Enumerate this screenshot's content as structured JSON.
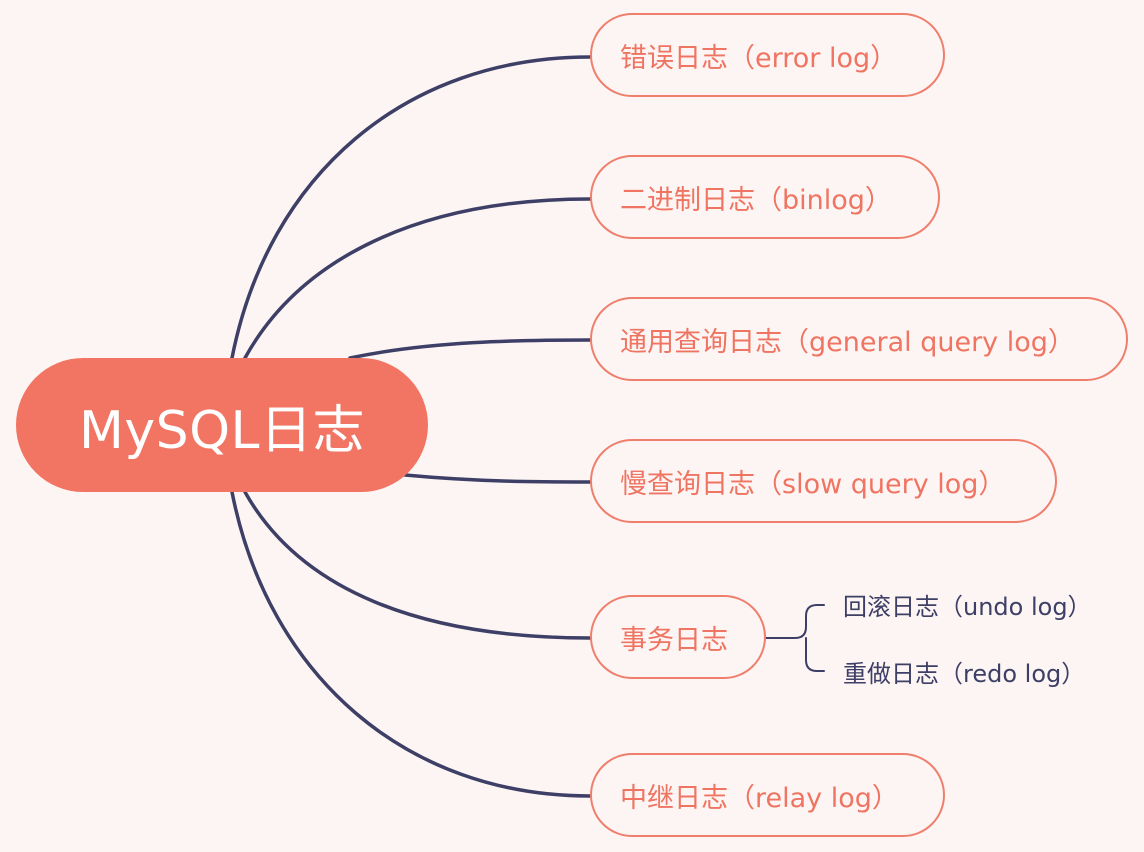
{
  "root": {
    "label": "MySQL日志"
  },
  "branches": [
    {
      "id": "error",
      "label": "错误日志（error log）"
    },
    {
      "id": "binlog",
      "label": "二进制日志（binlog）"
    },
    {
      "id": "general",
      "label": "通用查询日志（general query log）"
    },
    {
      "id": "slow",
      "label": "慢查询日志（slow query log）"
    },
    {
      "id": "transaction",
      "label": "事务日志",
      "children": [
        {
          "id": "undo",
          "label": "回滚日志（undo log）"
        },
        {
          "id": "redo",
          "label": "重做日志（redo log）"
        }
      ]
    },
    {
      "id": "relay",
      "label": "中继日志（relay log）"
    }
  ],
  "colors": {
    "background": "#fdf5f3",
    "root_fill": "#f27563",
    "root_text": "#ffffff",
    "branch_border": "#ef7f6c",
    "branch_text": "#ef7462",
    "connector": "#3d3f66",
    "sub_text": "#3d3f66"
  }
}
